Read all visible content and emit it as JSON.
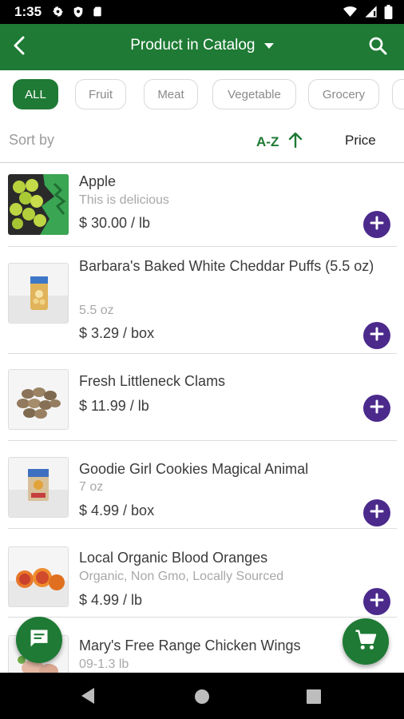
{
  "status_bar": {
    "time": "1:35",
    "left_icons": [
      "gear-icon",
      "shield-icon",
      "sd-card-icon"
    ],
    "right_icons": [
      "wifi-icon",
      "signal-icon",
      "battery-icon"
    ]
  },
  "app_bar": {
    "title": "Product in Catalog",
    "color": "#1e7a34"
  },
  "filters": {
    "chips": [
      "ALL",
      "Fruit",
      "Meat",
      "Vegetable",
      "Grocery",
      ""
    ],
    "active_index": 0
  },
  "sort": {
    "label": "Sort by",
    "az_label": "A-Z",
    "price_label": "Price"
  },
  "products": [
    {
      "name": "Apple",
      "description": "This is delicious",
      "price": "$ 30.00 / lb"
    },
    {
      "name": "Barbara's Baked White Cheddar Puffs (5.5 oz)",
      "description": "5.5 oz",
      "price": "$ 3.29 / box"
    },
    {
      "name": "Fresh Littleneck Clams",
      "description": "",
      "price": "$ 11.99 / lb"
    },
    {
      "name": "Goodie Girl Cookies Magical Animal",
      "description": "7 oz",
      "price": "$ 4.99 / box"
    },
    {
      "name": "Local Organic Blood Oranges",
      "description": "Organic, Non Gmo, Locally Sourced",
      "price": "$ 4.99 / lb"
    },
    {
      "name": "Mary's Free Range Chicken Wings",
      "description": "09-1.3 lb",
      "price": ""
    }
  ],
  "colors": {
    "primary": "#1e7a34",
    "add_button": "#4b2a8c"
  },
  "fabs": {
    "chat_icon": "chat-icon",
    "cart_icon": "cart-icon"
  }
}
